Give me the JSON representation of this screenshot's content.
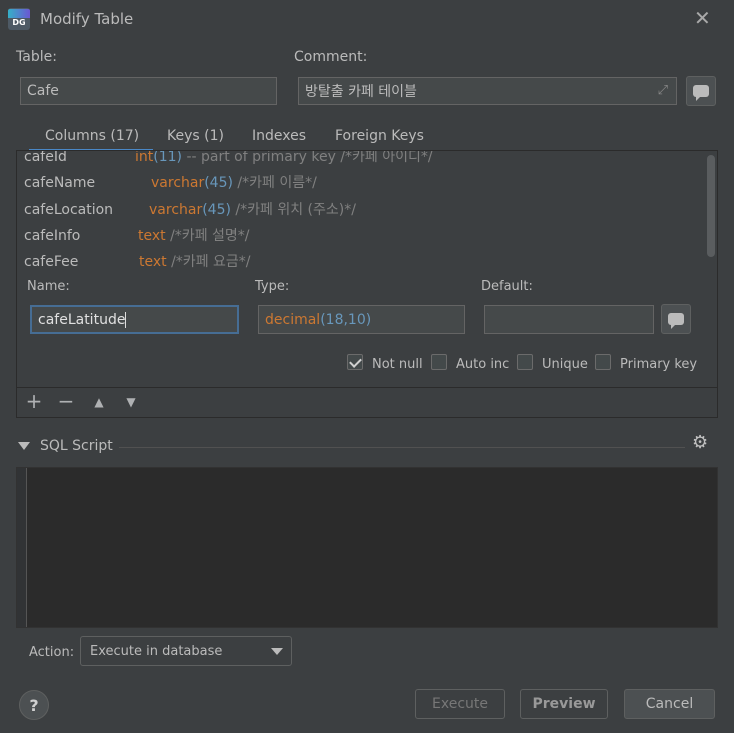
{
  "window": {
    "title": "Modify Table",
    "app_icon_text": "DG"
  },
  "table": {
    "label": "Table:",
    "value": "Cafe"
  },
  "comment": {
    "label": "Comment:",
    "value": "방탈출 카페 테이블"
  },
  "tabs": [
    {
      "label": "Columns (17)",
      "active": true
    },
    {
      "label": "Keys (1)",
      "active": false
    },
    {
      "label": "Indexes",
      "active": false
    },
    {
      "label": "Foreign Keys",
      "active": false
    }
  ],
  "columns": [
    {
      "name": "cafeId",
      "type": "int",
      "args": "(11)",
      "comment": "-- part of primary key /*카페 아이디*/"
    },
    {
      "name": "cafeName",
      "type": "varchar",
      "args": "(45)",
      "comment": "/*카페 이름*/"
    },
    {
      "name": "cafeLocation",
      "type": "varchar",
      "args": "(45)",
      "comment": "/*카페 위치 (주소)*/"
    },
    {
      "name": "cafeInfo",
      "type": "text",
      "args": "",
      "comment": "/*카페 설명*/"
    },
    {
      "name": "cafeFee",
      "type": "text",
      "args": "",
      "comment": "/*카페 요금*/"
    }
  ],
  "editor": {
    "name_label": "Name:",
    "type_label": "Type:",
    "default_label": "Default:",
    "name_value": "cafeLatitude",
    "type_keyword": "decimal",
    "type_args": "(18,10)",
    "default_value": ""
  },
  "options": [
    {
      "label": "Not null",
      "checked": true
    },
    {
      "label": "Auto inc",
      "checked": false
    },
    {
      "label": "Unique",
      "checked": false
    },
    {
      "label": "Primary key",
      "checked": false
    }
  ],
  "toolbar": {
    "add": "+",
    "remove": "−",
    "up": "▲",
    "down": "▼"
  },
  "sql": {
    "title": "SQL Script",
    "content": ""
  },
  "action": {
    "label": "Action:",
    "selected": "Execute in database"
  },
  "buttons": {
    "help": "?",
    "execute": "Execute",
    "preview": "Preview",
    "cancel": "Cancel"
  },
  "icons": {
    "expand": "expand-icon",
    "settings": "gear-icon",
    "comment": "comment-bubble-icon"
  }
}
